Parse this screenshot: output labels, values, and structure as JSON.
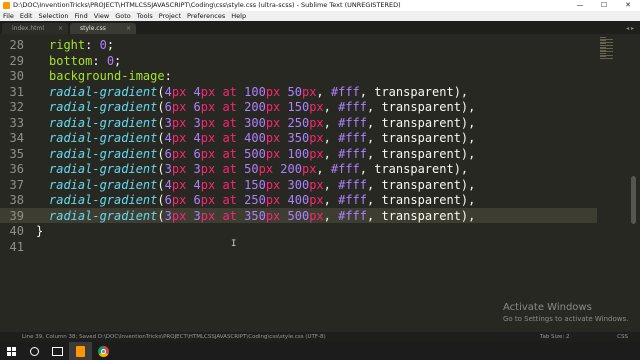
{
  "window": {
    "title": "D:\\DOC\\InventionTricks\\PROJECT\\HTMLCSSJAVASCRIPT\\Coding\\css\\style.css (ultra-scss) - Sublime Text (UNREGISTERED)",
    "controls": {
      "minimize": "—",
      "maximize": "☐",
      "close": "✕"
    }
  },
  "menu": [
    "File",
    "Edit",
    "Selection",
    "Find",
    "View",
    "Goto",
    "Tools",
    "Project",
    "Preferences",
    "Help"
  ],
  "tabs": [
    {
      "label": "index.html",
      "active": false,
      "close": "×"
    },
    {
      "label": "style.css",
      "active": true,
      "close": "×"
    }
  ],
  "tab_nav": "◂ ▸",
  "editor": {
    "current_line": 39,
    "lines": [
      {
        "num": "28",
        "tokens": [
          {
            "t": "right",
            "c": "prop"
          },
          {
            "t": ": "
          },
          {
            "t": "0",
            "c": "num"
          },
          {
            "t": ";"
          }
        ]
      },
      {
        "num": "29",
        "tokens": [
          {
            "t": "bottom",
            "c": "prop"
          },
          {
            "t": ": "
          },
          {
            "t": "0",
            "c": "num"
          },
          {
            "t": ";"
          }
        ]
      },
      {
        "num": "30",
        "tokens": [
          {
            "t": "background-image",
            "c": "prop"
          },
          {
            "t": ":"
          }
        ]
      },
      {
        "num": "31",
        "tokens": [
          {
            "t": "radial-gradient",
            "c": "fn"
          },
          {
            "t": "("
          },
          {
            "t": "4",
            "c": "num"
          },
          {
            "t": "px",
            "c": "unit"
          },
          {
            "t": " "
          },
          {
            "t": "4",
            "c": "num"
          },
          {
            "t": "px",
            "c": "unit"
          },
          {
            "t": " "
          },
          {
            "t": "at",
            "c": "kw"
          },
          {
            "t": " "
          },
          {
            "t": "100",
            "c": "num"
          },
          {
            "t": "px",
            "c": "unit"
          },
          {
            "t": " "
          },
          {
            "t": "50",
            "c": "num"
          },
          {
            "t": "px",
            "c": "unit"
          },
          {
            "t": ", "
          },
          {
            "t": "#fff",
            "c": "num"
          },
          {
            "t": ", transparent),"
          }
        ]
      },
      {
        "num": "32",
        "tokens": [
          {
            "t": "radial-gradient",
            "c": "fn"
          },
          {
            "t": "("
          },
          {
            "t": "6",
            "c": "num"
          },
          {
            "t": "px",
            "c": "unit"
          },
          {
            "t": " "
          },
          {
            "t": "6",
            "c": "num"
          },
          {
            "t": "px",
            "c": "unit"
          },
          {
            "t": " "
          },
          {
            "t": "at",
            "c": "kw"
          },
          {
            "t": " "
          },
          {
            "t": "200",
            "c": "num"
          },
          {
            "t": "px",
            "c": "unit"
          },
          {
            "t": " "
          },
          {
            "t": "150",
            "c": "num"
          },
          {
            "t": "px",
            "c": "unit"
          },
          {
            "t": ", "
          },
          {
            "t": "#fff",
            "c": "num"
          },
          {
            "t": ", transparent),"
          }
        ]
      },
      {
        "num": "33",
        "tokens": [
          {
            "t": "radial-gradient",
            "c": "fn"
          },
          {
            "t": "("
          },
          {
            "t": "3",
            "c": "num"
          },
          {
            "t": "px",
            "c": "unit"
          },
          {
            "t": " "
          },
          {
            "t": "3",
            "c": "num"
          },
          {
            "t": "px",
            "c": "unit"
          },
          {
            "t": " "
          },
          {
            "t": "at",
            "c": "kw"
          },
          {
            "t": " "
          },
          {
            "t": "300",
            "c": "num"
          },
          {
            "t": "px",
            "c": "unit"
          },
          {
            "t": " "
          },
          {
            "t": "250",
            "c": "num"
          },
          {
            "t": "px",
            "c": "unit"
          },
          {
            "t": ", "
          },
          {
            "t": "#fff",
            "c": "num"
          },
          {
            "t": ", transparent),"
          }
        ]
      },
      {
        "num": "34",
        "tokens": [
          {
            "t": "radial-gradient",
            "c": "fn"
          },
          {
            "t": "("
          },
          {
            "t": "4",
            "c": "num"
          },
          {
            "t": "px",
            "c": "unit"
          },
          {
            "t": " "
          },
          {
            "t": "4",
            "c": "num"
          },
          {
            "t": "px",
            "c": "unit"
          },
          {
            "t": " "
          },
          {
            "t": "at",
            "c": "kw"
          },
          {
            "t": " "
          },
          {
            "t": "400",
            "c": "num"
          },
          {
            "t": "px",
            "c": "unit"
          },
          {
            "t": " "
          },
          {
            "t": "350",
            "c": "num"
          },
          {
            "t": "px",
            "c": "unit"
          },
          {
            "t": ", "
          },
          {
            "t": "#fff",
            "c": "num"
          },
          {
            "t": ", transparent),"
          }
        ]
      },
      {
        "num": "35",
        "tokens": [
          {
            "t": "radial-gradient",
            "c": "fn"
          },
          {
            "t": "("
          },
          {
            "t": "6",
            "c": "num"
          },
          {
            "t": "px",
            "c": "unit"
          },
          {
            "t": " "
          },
          {
            "t": "6",
            "c": "num"
          },
          {
            "t": "px",
            "c": "unit"
          },
          {
            "t": " "
          },
          {
            "t": "at",
            "c": "kw"
          },
          {
            "t": " "
          },
          {
            "t": "500",
            "c": "num"
          },
          {
            "t": "px",
            "c": "unit"
          },
          {
            "t": " "
          },
          {
            "t": "100",
            "c": "num"
          },
          {
            "t": "px",
            "c": "unit"
          },
          {
            "t": ", "
          },
          {
            "t": "#fff",
            "c": "num"
          },
          {
            "t": ", transparent),"
          }
        ]
      },
      {
        "num": "36",
        "tokens": [
          {
            "t": "radial-gradient",
            "c": "fn"
          },
          {
            "t": "("
          },
          {
            "t": "3",
            "c": "num"
          },
          {
            "t": "px",
            "c": "unit"
          },
          {
            "t": " "
          },
          {
            "t": "3",
            "c": "num"
          },
          {
            "t": "px",
            "c": "unit"
          },
          {
            "t": " "
          },
          {
            "t": "at",
            "c": "kw"
          },
          {
            "t": " "
          },
          {
            "t": "50",
            "c": "num"
          },
          {
            "t": "px",
            "c": "unit"
          },
          {
            "t": " "
          },
          {
            "t": "200",
            "c": "num"
          },
          {
            "t": "px",
            "c": "unit"
          },
          {
            "t": ", "
          },
          {
            "t": "#fff",
            "c": "num"
          },
          {
            "t": ", transparent),"
          }
        ]
      },
      {
        "num": "37",
        "tokens": [
          {
            "t": "radial-gradient",
            "c": "fn"
          },
          {
            "t": "("
          },
          {
            "t": "4",
            "c": "num"
          },
          {
            "t": "px",
            "c": "unit"
          },
          {
            "t": " "
          },
          {
            "t": "4",
            "c": "num"
          },
          {
            "t": "px",
            "c": "unit"
          },
          {
            "t": " "
          },
          {
            "t": "at",
            "c": "kw"
          },
          {
            "t": " "
          },
          {
            "t": "150",
            "c": "num"
          },
          {
            "t": "px",
            "c": "unit"
          },
          {
            "t": " "
          },
          {
            "t": "300",
            "c": "num"
          },
          {
            "t": "px",
            "c": "unit"
          },
          {
            "t": ", "
          },
          {
            "t": "#fff",
            "c": "num"
          },
          {
            "t": ", transparent),"
          }
        ]
      },
      {
        "num": "38",
        "tokens": [
          {
            "t": "radial-gradient",
            "c": "fn"
          },
          {
            "t": "("
          },
          {
            "t": "6",
            "c": "num"
          },
          {
            "t": "px",
            "c": "unit"
          },
          {
            "t": " "
          },
          {
            "t": "6",
            "c": "num"
          },
          {
            "t": "px",
            "c": "unit"
          },
          {
            "t": " "
          },
          {
            "t": "at",
            "c": "kw"
          },
          {
            "t": " "
          },
          {
            "t": "250",
            "c": "num"
          },
          {
            "t": "px",
            "c": "unit"
          },
          {
            "t": " "
          },
          {
            "t": "400",
            "c": "num"
          },
          {
            "t": "px",
            "c": "unit"
          },
          {
            "t": ", "
          },
          {
            "t": "#fff",
            "c": "num"
          },
          {
            "t": ", transparent),"
          }
        ]
      },
      {
        "num": "39",
        "tokens": [
          {
            "t": "radial-gradient",
            "c": "fn"
          },
          {
            "t": "("
          },
          {
            "t": "3",
            "c": "num"
          },
          {
            "t": "px",
            "c": "unit"
          },
          {
            "t": " "
          },
          {
            "t": "3",
            "c": "num"
          },
          {
            "t": "px",
            "c": "unit"
          },
          {
            "t": " "
          },
          {
            "t": "at",
            "c": "kw"
          },
          {
            "t": " "
          },
          {
            "t": "350",
            "c": "num"
          },
          {
            "t": "px",
            "c": "unit"
          },
          {
            "t": " "
          },
          {
            "t": "500",
            "c": "num"
          },
          {
            "t": "px",
            "c": "unit"
          },
          {
            "t": ", "
          },
          {
            "t": "#fff",
            "c": "num"
          },
          {
            "t": ", transparent),"
          }
        ]
      },
      {
        "num": "40",
        "closing": true,
        "tokens": [
          {
            "t": "}"
          }
        ]
      },
      {
        "num": "41",
        "tokens": []
      }
    ]
  },
  "watermark": {
    "heading": "Activate Windows",
    "sub": "Go to Settings to activate Windows."
  },
  "statusbar": {
    "left": "Line 39, Column 38; Saved D:\\DOC\\InventionTricks\\PROJECT\\HTMLCSSJAVASCRIPT\\Coding\\css\\style.css (UTF-8)",
    "tab_size": "Tab Size: 2",
    "syntax": "CSS"
  },
  "taskbar": {
    "items": [
      "windows-start",
      "search",
      "task-view",
      "sublime-text",
      "chrome"
    ],
    "active": "sublime-text"
  },
  "colors": {
    "editor_bg": "#272822",
    "function": "#66d9ef",
    "property": "#a6e22e",
    "number": "#ae81ff",
    "unit_keyword": "#f92672",
    "text": "#f8f8f2",
    "line_number": "#8f908a"
  }
}
